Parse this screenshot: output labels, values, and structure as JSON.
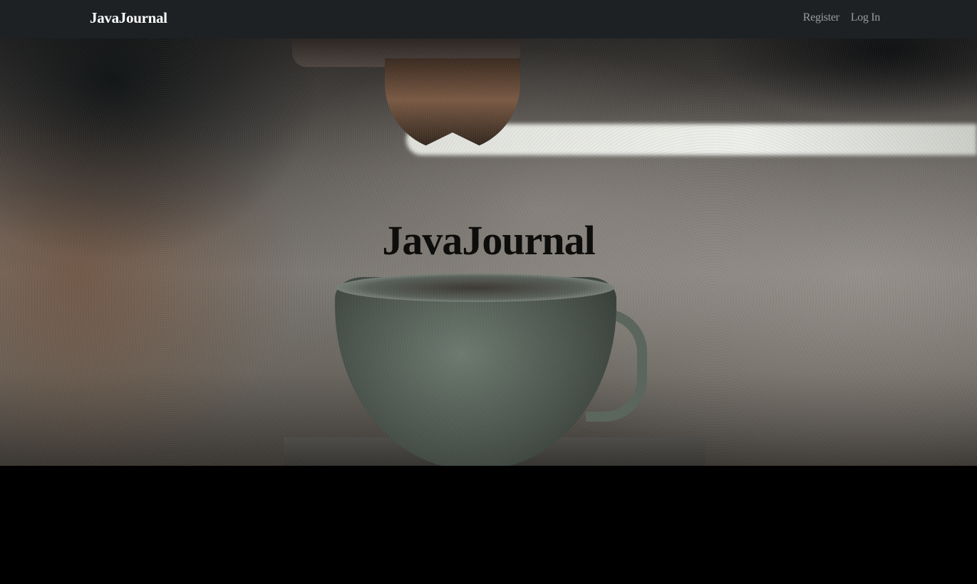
{
  "navbar": {
    "brand": "JavaJournal",
    "links": [
      {
        "label": "Register"
      },
      {
        "label": "Log In"
      }
    ]
  },
  "hero": {
    "title": "JavaJournal",
    "background_image": "espresso-machine-pouring-into-green-cup"
  },
  "colors": {
    "navbar_bg": "#1d2124",
    "brand_text": "#ffffff",
    "nav_link_text": "#9a9d9f",
    "hero_title_text": "#0d0d0c",
    "page_bg": "#000000"
  }
}
